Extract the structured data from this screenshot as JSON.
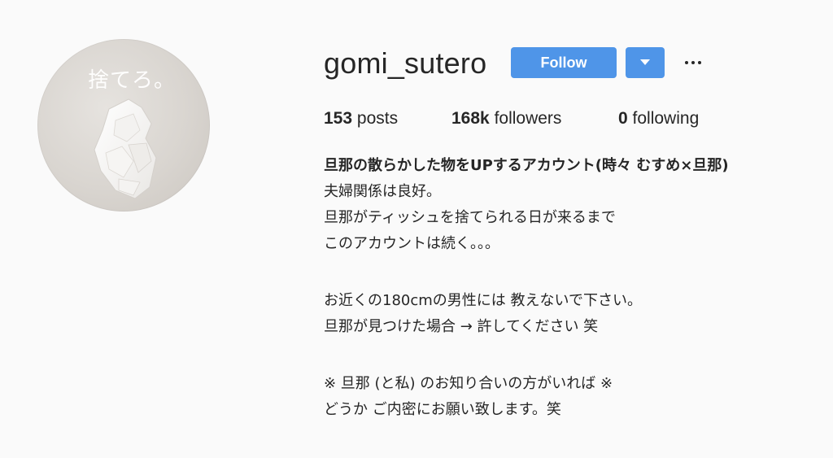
{
  "profile": {
    "username": "gomi_sutero",
    "avatar_caption": "捨てろ。"
  },
  "actions": {
    "follow_label": "Follow",
    "dropdown_icon": "caret-down-icon",
    "more_icon": "more-options-icon"
  },
  "stats": {
    "posts_count": "153",
    "posts_label": "posts",
    "followers_count": "168k",
    "followers_label": "followers",
    "following_count": "0",
    "following_label": "following"
  },
  "bio": {
    "headline": "旦那の散らかした物をUPするアカウント(時々 むすめ×旦那)",
    "line1": "夫婦関係は良好。",
    "line2": "旦那がティッシュを捨てられる日が来るまで",
    "line3": "このアカウントは続く。。。",
    "line4": "お近くの180cmの男性には 教えないで下さい。",
    "line5": "旦那が見つけた場合 → 許してください 笑",
    "line6": "※ 旦那 (と私) のお知り合いの方がいれば ※",
    "line7": "どうか ご内密にお願い致します。笑"
  },
  "colors": {
    "accent": "#4f95e8",
    "text": "#262626",
    "background": "#fafafa"
  }
}
